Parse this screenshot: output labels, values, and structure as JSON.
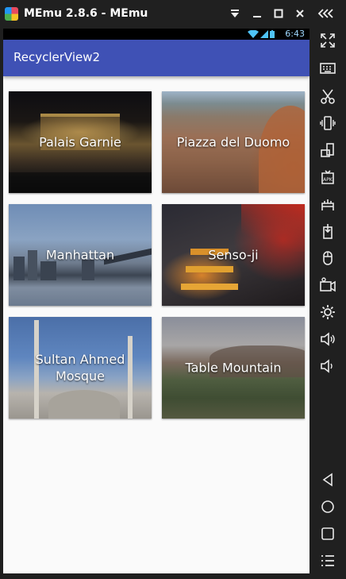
{
  "window": {
    "title": "MEmu 2.8.6 - MEmu",
    "controls": [
      {
        "name": "dropdown-icon",
        "glyph": "▼"
      },
      {
        "name": "minimize-icon",
        "glyph": "—"
      },
      {
        "name": "maximize-icon",
        "glyph": "☐"
      },
      {
        "name": "close-icon",
        "glyph": "✕"
      },
      {
        "name": "collapse-sidebar-icon",
        "glyph": "❮❮❮"
      }
    ]
  },
  "statusbar": {
    "time": "6:43",
    "icons": [
      "wifi-icon",
      "signal-icon",
      "battery-icon"
    ]
  },
  "appbar": {
    "title": "RecyclerView2",
    "color": "#3f51b5"
  },
  "cards": [
    {
      "label": "Palais Garnie",
      "image": "palais-garnier-photo"
    },
    {
      "label": "Piazza del Duomo",
      "image": "piazza-del-duomo-photo"
    },
    {
      "label": "Manhattan",
      "image": "manhattan-photo"
    },
    {
      "label": "Senso-ji",
      "image": "senso-ji-photo"
    },
    {
      "label": "Sultan Ahmed Mosque",
      "image": "sultan-ahmed-mosque-photo"
    },
    {
      "label": "Table Mountain",
      "image": "table-mountain-photo"
    }
  ],
  "sidebar": {
    "buttons": [
      "fullscreen-icon",
      "keyboard-icon",
      "scissors-icon",
      "shake-icon",
      "rotate-icon",
      "apk-icon",
      "network-icon",
      "install-icon",
      "mouse-icon",
      "record-icon",
      "settings-icon",
      "volume-up-icon",
      "volume-down-icon",
      "back-icon",
      "home-icon",
      "recents-icon",
      "menu-icon"
    ]
  }
}
